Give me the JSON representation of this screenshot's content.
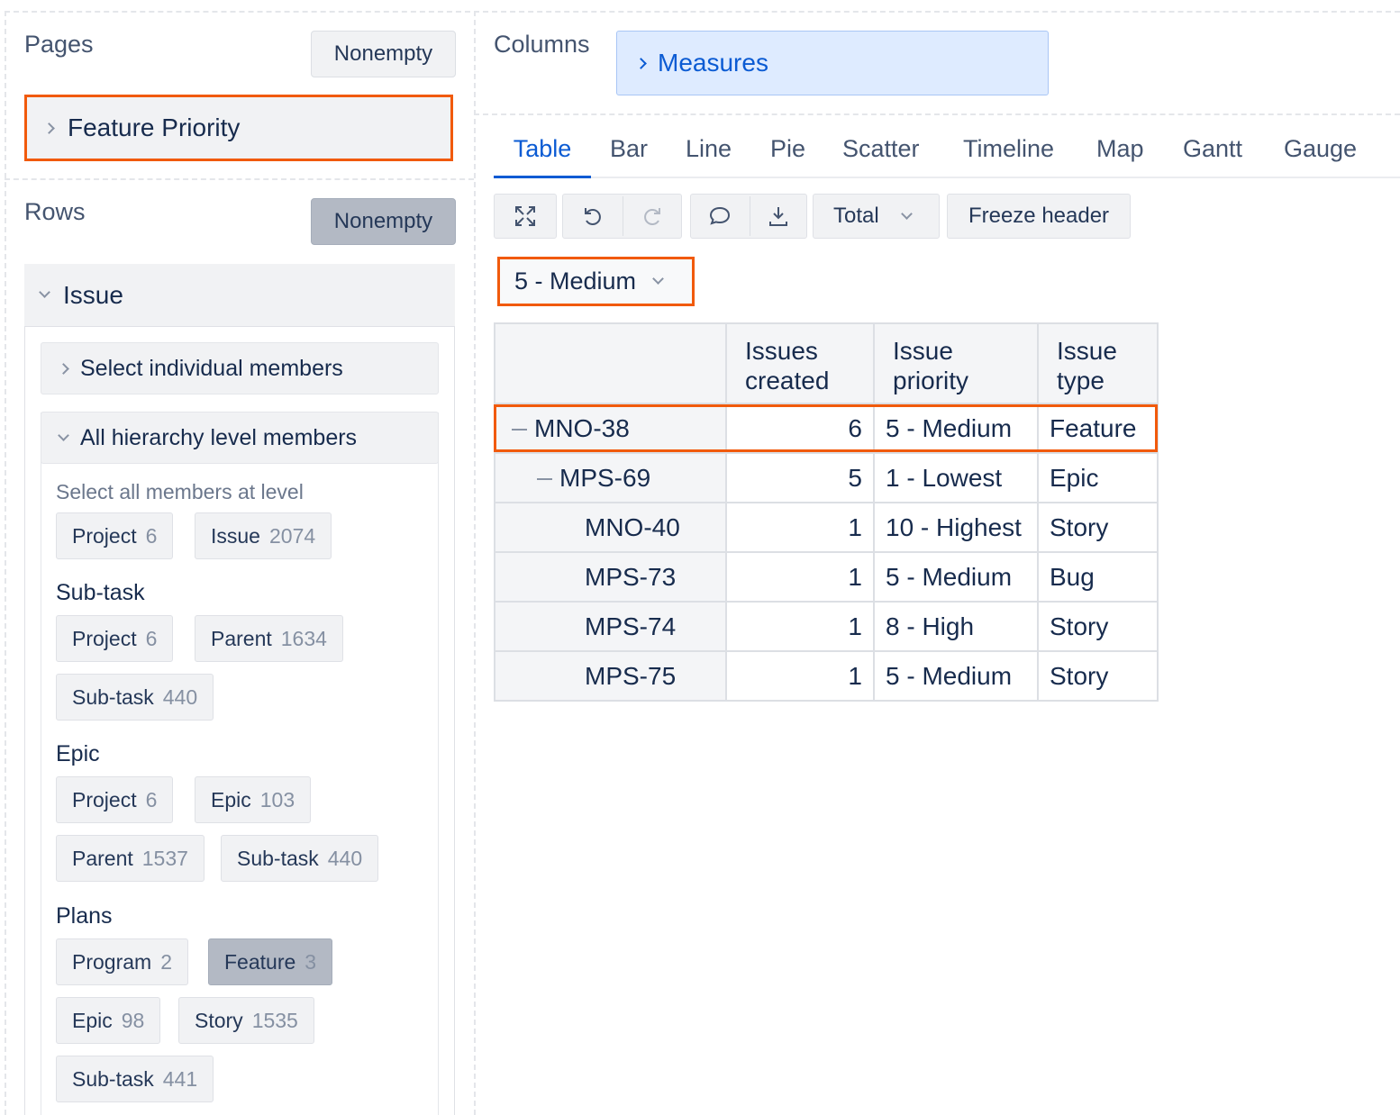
{
  "pages": {
    "title": "Pages",
    "nonempty_label": "Nonempty",
    "selected_dimension": "Feature Priority"
  },
  "rows_panel": {
    "title": "Rows",
    "nonempty_label": "Nonempty",
    "dimension": "Issue",
    "select_individual": "Select individual members",
    "all_hierarchy": "All hierarchy level members",
    "select_all_hint": "Select all members at level",
    "default_levels": [
      {
        "label": "Project",
        "count": "6"
      },
      {
        "label": "Issue",
        "count": "2074"
      }
    ],
    "groups": [
      {
        "title": "Sub-task",
        "levels": [
          {
            "label": "Project",
            "count": "6"
          },
          {
            "label": "Parent",
            "count": "1634"
          },
          {
            "label": "Sub-task",
            "count": "440"
          }
        ]
      },
      {
        "title": "Epic",
        "levels": [
          {
            "label": "Project",
            "count": "6"
          },
          {
            "label": "Epic",
            "count": "103"
          },
          {
            "label": "Parent",
            "count": "1537"
          },
          {
            "label": "Sub-task",
            "count": "440"
          }
        ]
      },
      {
        "title": "Plans",
        "levels": [
          {
            "label": "Program",
            "count": "2"
          },
          {
            "label": "Feature",
            "count": "3",
            "active": true
          },
          {
            "label": "Epic",
            "count": "98"
          },
          {
            "label": "Story",
            "count": "1535"
          },
          {
            "label": "Sub-task",
            "count": "441"
          }
        ]
      }
    ]
  },
  "columns": {
    "title": "Columns",
    "measures_label": "Measures"
  },
  "view_tabs": [
    "Table",
    "Bar",
    "Line",
    "Pie",
    "Scatter",
    "Timeline",
    "Map",
    "Gantt",
    "Gauge"
  ],
  "active_tab": "Table",
  "toolbar": {
    "icons": [
      "fullscreen-icon",
      "undo-icon",
      "redo-icon",
      "comment-icon",
      "download-icon"
    ],
    "total_label": "Total",
    "freeze_label": "Freeze header"
  },
  "page_filter": {
    "selected": "5 - Medium"
  },
  "table": {
    "headers": [
      "",
      "Issues\ncreated",
      "Issue\npriority",
      "Issue\ntype"
    ],
    "header_lines": [
      [],
      [
        "Issues",
        "created"
      ],
      [
        "Issue",
        "priority"
      ],
      [
        "Issue",
        "type"
      ]
    ],
    "rows": [
      {
        "key": "MNO-38",
        "level": 0,
        "expanded": true,
        "issues_created": "6",
        "priority": "5 - Medium",
        "type": "Feature",
        "highlighted": true
      },
      {
        "key": "MPS-69",
        "level": 1,
        "expanded": true,
        "issues_created": "5",
        "priority": "1 - Lowest",
        "type": "Epic"
      },
      {
        "key": "MNO-40",
        "level": 2,
        "issues_created": "1",
        "priority": "10 - Highest",
        "type": "Story"
      },
      {
        "key": "MPS-73",
        "level": 2,
        "issues_created": "1",
        "priority": "5 - Medium",
        "type": "Bug"
      },
      {
        "key": "MPS-74",
        "level": 2,
        "issues_created": "1",
        "priority": "8 - High",
        "type": "Story"
      },
      {
        "key": "MPS-75",
        "level": 2,
        "issues_created": "1",
        "priority": "5 - Medium",
        "type": "Story"
      }
    ]
  },
  "colors": {
    "highlight": "#f15a0c",
    "accent": "#0b5bd3",
    "measures_bg": "#deebff"
  }
}
